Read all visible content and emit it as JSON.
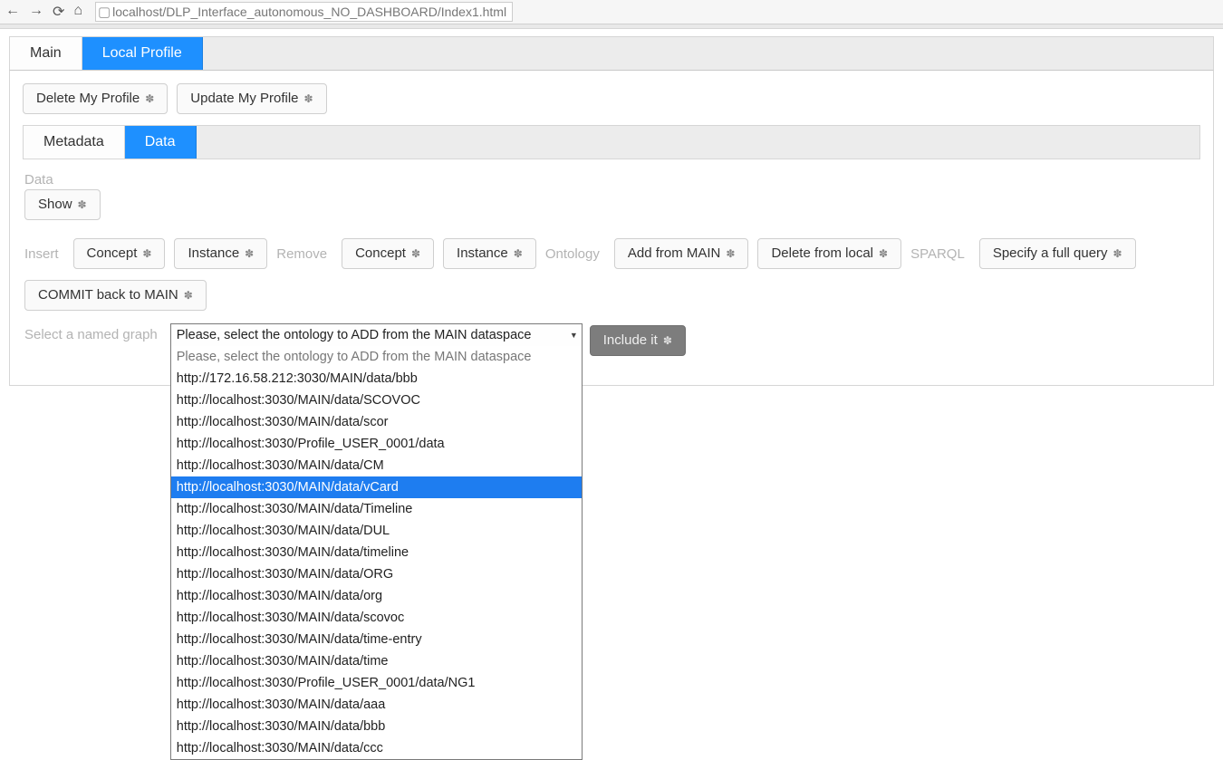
{
  "browser": {
    "url": "localhost/DLP_Interface_autonomous_NO_DASHBOARD/Index1.html"
  },
  "outerTabs": {
    "main": "Main",
    "localProfile": "Local Profile"
  },
  "profileButtons": {
    "delete": "Delete My Profile",
    "update": "Update My Profile"
  },
  "innerTabs": {
    "metadata": "Metadata",
    "data": "Data"
  },
  "dataSection": {
    "dataLabel": "Data",
    "show": "Show",
    "insertLabel": "Insert",
    "insertConcept": "Concept",
    "insertInstance": "Instance",
    "removeLabel": "Remove",
    "removeConcept": "Concept",
    "removeInstance": "Instance",
    "ontologyLabel": "Ontology",
    "addFromMain": "Add from MAIN",
    "deleteFromLocal": "Delete from local",
    "sparqlLabel": "SPARQL",
    "specifyQuery": "Specify a full query",
    "commit": "COMMIT back to MAIN",
    "selectNamedGraphLabel": "Select a named graph",
    "selectPlaceholder": "Please, select the ontology to ADD from the MAIN dataspace",
    "includeIt": "Include it"
  },
  "dropdown": {
    "highlightIndex": 6,
    "options": [
      "Please, select the ontology to ADD from the MAIN dataspace",
      "http://172.16.58.212:3030/MAIN/data/bbb",
      "http://localhost:3030/MAIN/data/SCOVOC",
      "http://localhost:3030/MAIN/data/scor",
      "http://localhost:3030/Profile_USER_0001/data",
      "http://localhost:3030/MAIN/data/CM",
      "http://localhost:3030/MAIN/data/vCard",
      "http://localhost:3030/MAIN/data/Timeline",
      "http://localhost:3030/MAIN/data/DUL",
      "http://localhost:3030/MAIN/data/timeline",
      "http://localhost:3030/MAIN/data/ORG",
      "http://localhost:3030/MAIN/data/org",
      "http://localhost:3030/MAIN/data/scovoc",
      "http://localhost:3030/MAIN/data/time-entry",
      "http://localhost:3030/MAIN/data/time",
      "http://localhost:3030/Profile_USER_0001/data/NG1",
      "http://localhost:3030/MAIN/data/aaa",
      "http://localhost:3030/MAIN/data/bbb",
      "http://localhost:3030/MAIN/data/ccc"
    ]
  }
}
